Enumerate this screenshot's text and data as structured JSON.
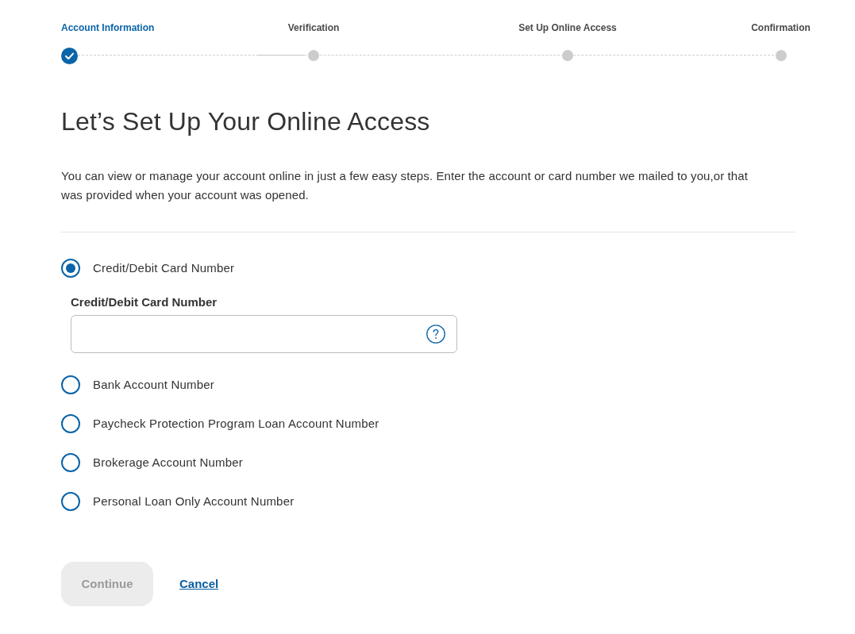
{
  "stepper": {
    "steps": [
      {
        "label": "Account Information",
        "completed": true
      },
      {
        "label": "Verification",
        "completed": false
      },
      {
        "label": "Set Up Online Access",
        "completed": false
      },
      {
        "label": "Confirmation",
        "completed": false
      }
    ]
  },
  "heading": "Let’s Set Up Your Online Access",
  "intro": "You can view or manage your account online in just a few easy steps. Enter the account or card number we mailed to you,or that was provided when your account was opened.",
  "account_types": [
    {
      "label": "Credit/Debit Card Number",
      "selected": true,
      "field": {
        "label": "Credit/Debit Card Number"
      }
    },
    {
      "label": "Bank Account Number",
      "selected": false
    },
    {
      "label": "Paycheck Protection Program Loan Account Number",
      "selected": false
    },
    {
      "label": "Brokerage Account Number",
      "selected": false
    },
    {
      "label": "Personal Loan Only Account Number",
      "selected": false
    }
  ],
  "actions": {
    "continue": {
      "label": "Continue",
      "disabled": true
    },
    "cancel": {
      "label": "Cancel"
    }
  }
}
